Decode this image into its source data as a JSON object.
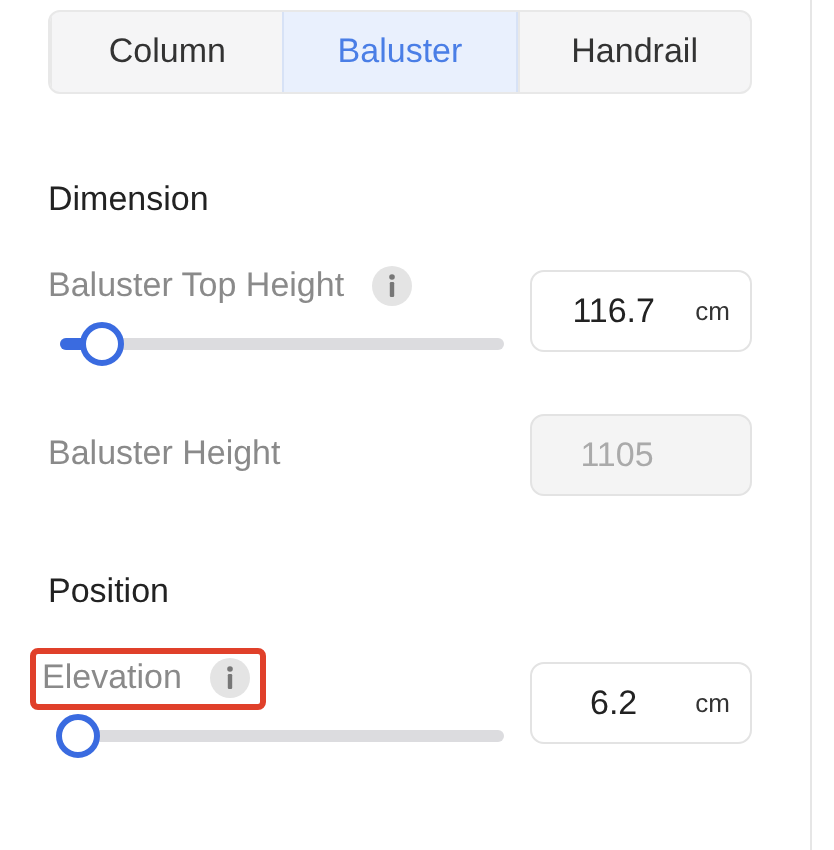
{
  "tabs": [
    {
      "label": "Column",
      "selected": false
    },
    {
      "label": "Baluster",
      "selected": true
    },
    {
      "label": "Handrail",
      "selected": false
    }
  ],
  "sections": [
    {
      "heading": "Dimension",
      "fields": [
        {
          "kind": "slider",
          "label": "Baluster Top Height",
          "info": true,
          "highlighted": false,
          "level": 0.06,
          "value": "116.7",
          "unit": "cm"
        },
        {
          "kind": "readonly",
          "label": "Baluster Height",
          "info": false,
          "highlighted": false,
          "value": "1105"
        }
      ]
    },
    {
      "heading": "Position",
      "fields": [
        {
          "kind": "slider",
          "label": "Elevation",
          "info": true,
          "highlighted": true,
          "level": 0,
          "value": "6.2",
          "unit": "cm"
        }
      ]
    }
  ]
}
